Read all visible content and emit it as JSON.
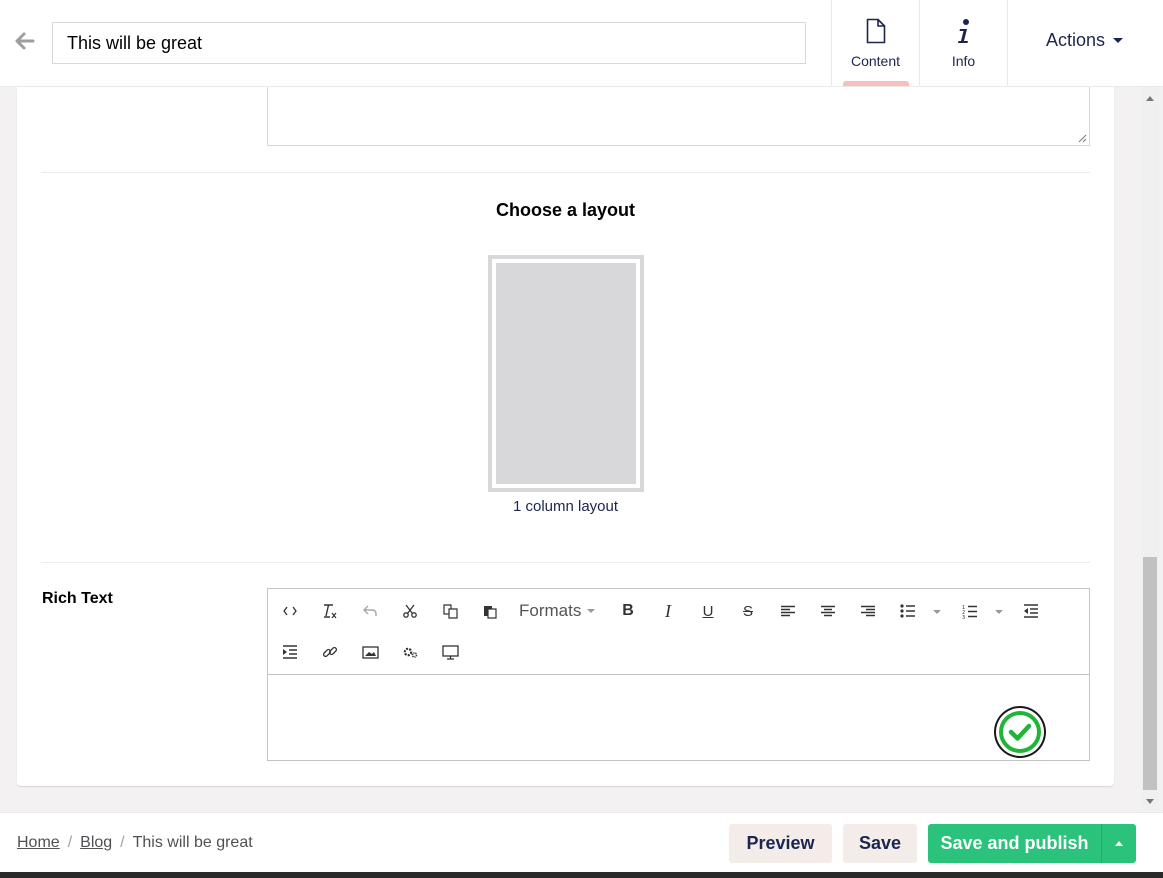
{
  "header": {
    "title_value": "This will be great",
    "tabs": [
      {
        "label": "Content",
        "icon": "document-icon",
        "active": true
      },
      {
        "label": "Info",
        "icon": "info-icon",
        "active": false
      }
    ],
    "actions_label": "Actions"
  },
  "main": {
    "layout_heading": "Choose a layout",
    "layouts": [
      {
        "label": "1 column layout"
      }
    ],
    "rich_text_label": "Rich Text",
    "toolbar": {
      "formats_label": "Formats",
      "bold": "B",
      "italic": "I",
      "underline": "U",
      "strikethrough": "S"
    }
  },
  "footer": {
    "breadcrumb": [
      "Home",
      "Blog",
      "This will be great"
    ],
    "separator": "/",
    "preview_label": "Preview",
    "save_label": "Save",
    "publish_label": "Save and publish"
  },
  "colors": {
    "primary_text": "#1b264f",
    "publish_green": "#2bc37c",
    "active_tab_indicator": "#f5c1bc",
    "background": "#f3f1f1"
  }
}
